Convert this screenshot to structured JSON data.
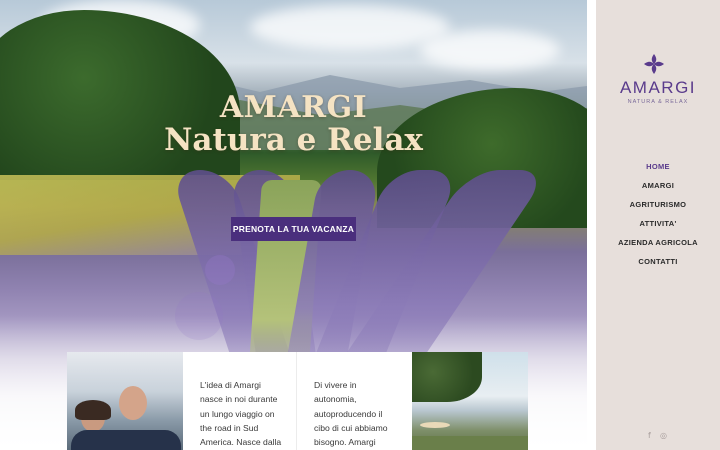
{
  "hero": {
    "title_line1": "AMARGI",
    "title_line2": "Natura e Relax",
    "cta_label": "PRENOTA LA TUA VACANZA"
  },
  "intro": {
    "paragraph1": "L'idea di Amargi nasce in noi durante un lungo viaggio on the road in Sud America. Nasce dalla",
    "paragraph2": "Di vivere in autonomia, autoproducendo il cibo di cui abbiamo bisogno. Amargi"
  },
  "sidebar": {
    "logo_name": "AMARGI",
    "logo_tagline": "NATURA & RELAX",
    "nav": [
      {
        "label": "HOME",
        "active": true
      },
      {
        "label": "AMARGI",
        "active": false
      },
      {
        "label": "AGRITURISMO",
        "active": false
      },
      {
        "label": "ATTIVITA'",
        "active": false
      },
      {
        "label": "AZIENDA AGRICOLA",
        "active": false
      },
      {
        "label": "CONTATTI",
        "active": false
      }
    ],
    "social_icons": [
      "facebook-icon",
      "instagram-icon"
    ]
  },
  "colors": {
    "brand_purple": "#5a3b8c",
    "cta_purple": "#4a2f7d",
    "sidebar_bg": "#e7dfdb",
    "title_cream": "#f5e3c3"
  }
}
